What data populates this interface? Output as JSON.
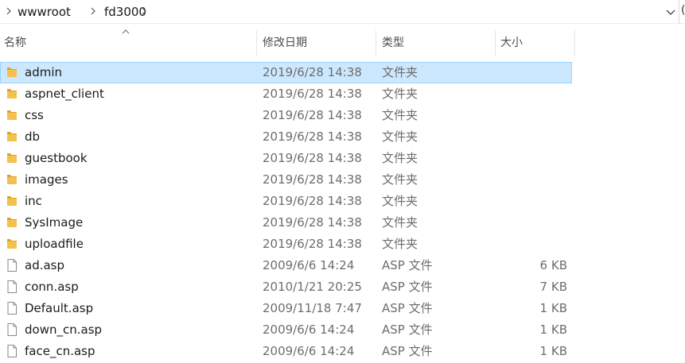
{
  "address_bar": {
    "crumbs": [
      "wwwroot",
      "fd3000"
    ],
    "right_edge_glyph": "("
  },
  "columns": {
    "name": "名称",
    "date": "修改日期",
    "type": "类型",
    "size": "大小"
  },
  "colors": {
    "folder": "#f2c14e",
    "folder_dark": "#dca22a",
    "selection_bg": "#cce8ff",
    "selection_border": "#99d1ff"
  },
  "files": [
    {
      "icon": "folder-icon",
      "name": "admin",
      "date": "2019/6/28 14:38",
      "type": "文件夹",
      "size": "",
      "selected": true
    },
    {
      "icon": "folder-icon",
      "name": "aspnet_client",
      "date": "2019/6/28 14:38",
      "type": "文件夹",
      "size": ""
    },
    {
      "icon": "folder-icon",
      "name": "css",
      "date": "2019/6/28 14:38",
      "type": "文件夹",
      "size": ""
    },
    {
      "icon": "folder-icon",
      "name": "db",
      "date": "2019/6/28 14:38",
      "type": "文件夹",
      "size": ""
    },
    {
      "icon": "folder-icon",
      "name": "guestbook",
      "date": "2019/6/28 14:38",
      "type": "文件夹",
      "size": ""
    },
    {
      "icon": "folder-icon",
      "name": "images",
      "date": "2019/6/28 14:38",
      "type": "文件夹",
      "size": ""
    },
    {
      "icon": "folder-icon",
      "name": "inc",
      "date": "2019/6/28 14:38",
      "type": "文件夹",
      "size": ""
    },
    {
      "icon": "folder-icon",
      "name": "SysImage",
      "date": "2019/6/28 14:38",
      "type": "文件夹",
      "size": ""
    },
    {
      "icon": "folder-icon",
      "name": "uploadfile",
      "date": "2019/6/28 14:38",
      "type": "文件夹",
      "size": ""
    },
    {
      "icon": "file-icon",
      "name": "ad.asp",
      "date": "2009/6/6 14:24",
      "type": "ASP 文件",
      "size": "6 KB"
    },
    {
      "icon": "file-icon",
      "name": "conn.asp",
      "date": "2010/1/21 20:25",
      "type": "ASP 文件",
      "size": "7 KB"
    },
    {
      "icon": "file-icon",
      "name": "Default.asp",
      "date": "2009/11/18 7:47",
      "type": "ASP 文件",
      "size": "1 KB"
    },
    {
      "icon": "file-icon",
      "name": "down_cn.asp",
      "date": "2009/6/6 14:24",
      "type": "ASP 文件",
      "size": "1 KB"
    },
    {
      "icon": "file-icon",
      "name": "face_cn.asp",
      "date": "2009/6/6 14:24",
      "type": "ASP 文件",
      "size": "1 KB"
    }
  ]
}
